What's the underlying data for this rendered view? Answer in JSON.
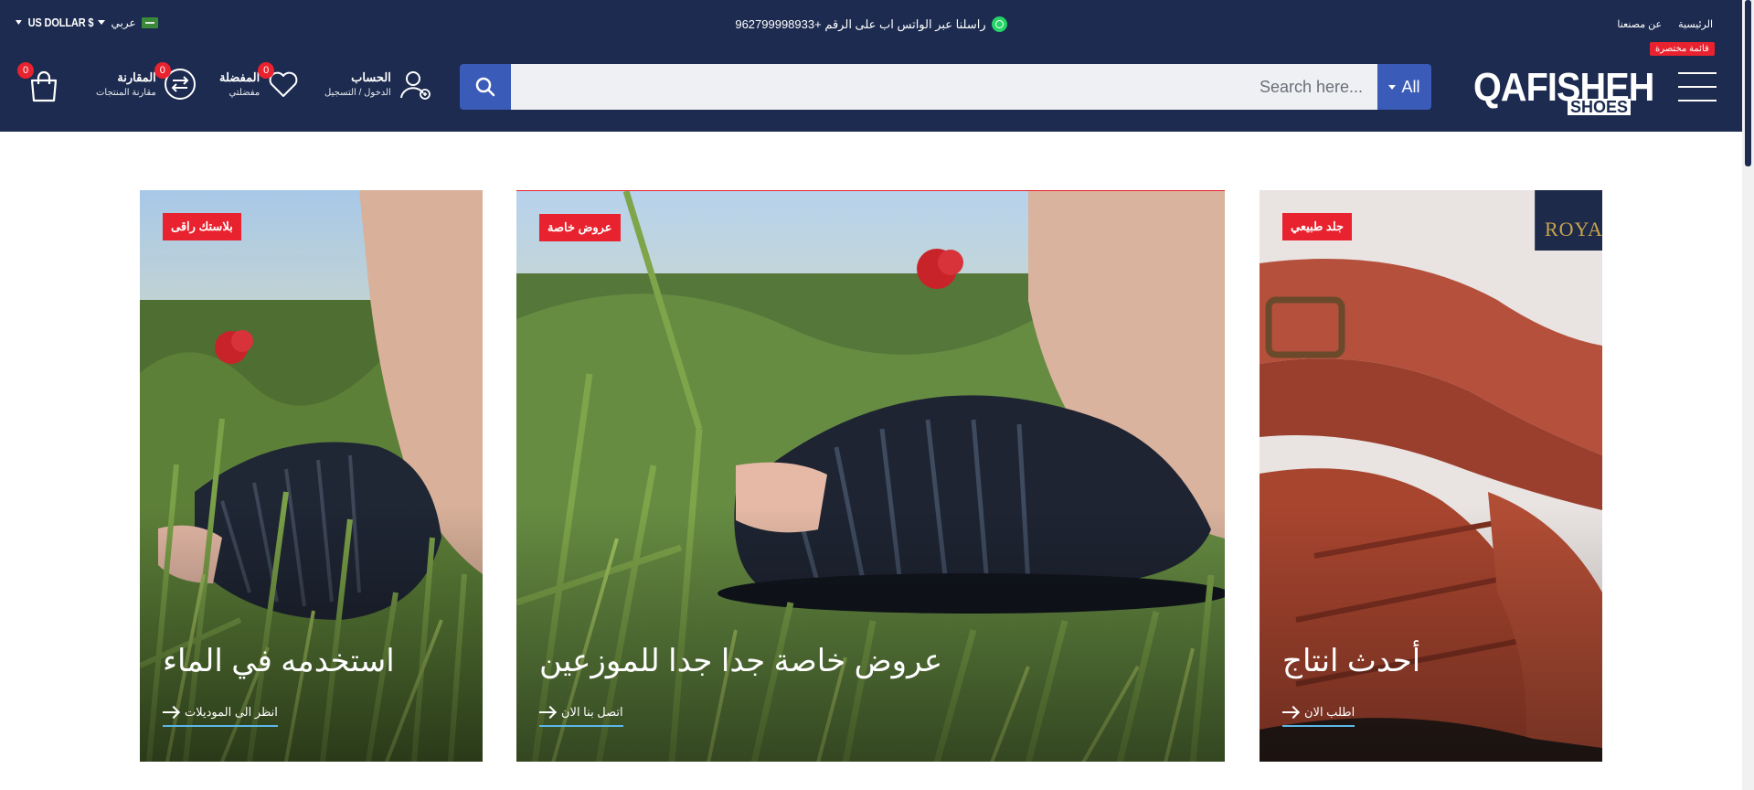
{
  "topbar": {
    "currency": "US DOLLAR $",
    "language": "عربي",
    "whatsapp_text": "راسلنا عبر الواتس اب على الرقم +962799998933",
    "links": [
      "الرئيسية",
      "عن مصنعنا"
    ]
  },
  "header": {
    "cart_count": "0",
    "compare": {
      "count": "0",
      "title": "المقارنة",
      "subtitle": "مقارنة المنتجات"
    },
    "wishlist": {
      "count": "0",
      "title": "المفضلة",
      "subtitle": "مفضلتي"
    },
    "account": {
      "title": "الحساب",
      "subtitle": "الدخول / التسجيل"
    },
    "search": {
      "placeholder": "Search here...",
      "category": "All"
    },
    "logo": {
      "main": "QAFISHEH",
      "sub": "SHOES"
    },
    "menu_badge": "قائمة مختصرة"
  },
  "banners": [
    {
      "tag": "بلاستك راقى",
      "title": "استخدمه في الماء",
      "link": "انظر الى الموديلات"
    },
    {
      "tag": "عروض خاصة",
      "title": "عروض خاصة جدا جدا للموزعين",
      "link": "اتصل بنا الان"
    },
    {
      "tag": "جلد طبيعي",
      "title": "أحدث انتاج",
      "link": "اطلب الان",
      "brand_sign": "ROYA"
    }
  ],
  "colors": {
    "header_bg": "#1c2b4f",
    "accent_blue": "#3a5bb8",
    "badge_red": "#e8222e",
    "link_underline": "#5bb7e8"
  },
  "icons": [
    "cart-icon",
    "compare-icon",
    "heart-icon",
    "user-icon",
    "search-icon",
    "whatsapp-icon",
    "hamburger-icon",
    "flag-icon",
    "arrow-right-icon"
  ]
}
